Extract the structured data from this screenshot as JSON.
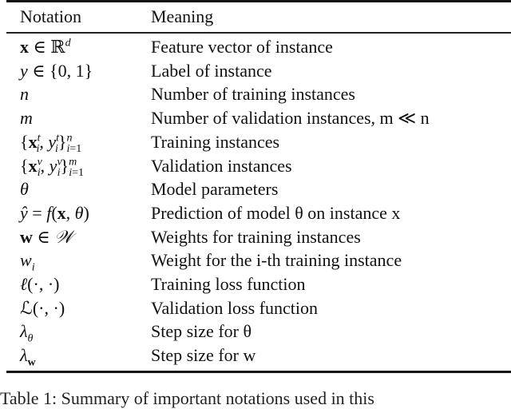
{
  "table": {
    "headers": [
      "Notation",
      "Meaning"
    ],
    "rows": [
      {
        "notation": "x ∈ ℝ^d",
        "meaning": "Feature vector of instance"
      },
      {
        "notation": "y ∈ {0, 1}",
        "meaning": "Label of instance"
      },
      {
        "notation": "n",
        "meaning": "Number of training instances"
      },
      {
        "notation": "m",
        "meaning": "Number of validation instances, m ≪ n"
      },
      {
        "notation": "{x_i^t, y_i^t}_{i=1}^n",
        "meaning": "Training instances"
      },
      {
        "notation": "{x_i^v, y_i^v}_{i=1}^m",
        "meaning": "Validation instances"
      },
      {
        "notation": "θ",
        "meaning": "Model parameters"
      },
      {
        "notation": "ŷ = f(x, θ)",
        "meaning": "Prediction of model θ on instance x"
      },
      {
        "notation": "w ∈ 𝒲",
        "meaning": "Weights for training instances"
      },
      {
        "notation": "w_i",
        "meaning": "Weight for the i-th training instance"
      },
      {
        "notation": "ℓ(·, ·)",
        "meaning": "Training loss function"
      },
      {
        "notation": "ℒ(·, ·)",
        "meaning": "Validation loss function"
      },
      {
        "notation": "λ_θ",
        "meaning": "Step size for θ"
      },
      {
        "notation": "λ_w",
        "meaning": "Step size for w"
      }
    ]
  },
  "caption": "Table 1: Summary of important notations used in this"
}
